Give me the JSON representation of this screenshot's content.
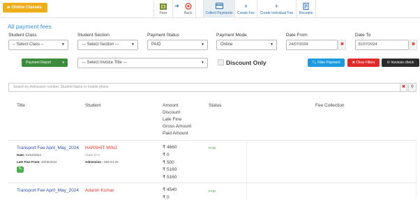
{
  "topbar": {
    "online_classes": "Online Classes",
    "tabs": [
      {
        "label": "Fees",
        "icon": "fees-icon"
      },
      {
        "label": "Back",
        "icon": "back-icon"
      },
      {
        "label": "Collect Payments",
        "icon": "collect-payments-icon"
      },
      {
        "label": "Create Fee",
        "icon": "plus-icon"
      },
      {
        "label": "Create Individual Fee",
        "icon": "plus-icon"
      },
      {
        "label": "Receipts",
        "icon": "receipts-icon"
      }
    ]
  },
  "page_title": "All payment fees",
  "filters": {
    "student_class": {
      "label": "Student Class",
      "value": "-- Select Class --"
    },
    "student_section": {
      "label": "Student Section",
      "value": "--- Select Section ---"
    },
    "payment_status": {
      "label": "Payment Status",
      "value": "PAID"
    },
    "payment_mode": {
      "label": "Payment Mode",
      "value": "Online"
    },
    "date_from": {
      "label": "Date From",
      "value": "24/07/2024"
    },
    "date_to": {
      "label": "Date To",
      "value": "31/07/2024"
    },
    "invoice_title": {
      "value": "--- Select Invoice Title ---"
    },
    "discount_only": "Discount Only"
  },
  "buttons": {
    "payment_report": "Payment Report",
    "filter_payment": "Filter Payment",
    "clear_filters": "Clear Filters",
    "invoices_check": "Invoices check"
  },
  "search": {
    "placeholder": "Search by Admission number, Student Name or mobile phone"
  },
  "table": {
    "headers": {
      "title": "Title",
      "student": "Student",
      "amount": "Amount",
      "discount": "Discount",
      "late_fine": "Late Fine",
      "gross_amount": "Gross Amount",
      "paid_amount": "Paid Amount",
      "status": "Status",
      "fee_collection": "Fee Collection"
    },
    "rows": [
      {
        "title": "Transport Fee April_May_2024",
        "date_label": "Date:",
        "date": "01/04/2024",
        "late_fine_label": "Late Fine From:",
        "late_fine_from": "20/05/2024",
        "student": "HARSHIT MINJ",
        "class": "Class IV-A",
        "admission_label": "Admission :",
        "admission": "360-24-25",
        "amounts": [
          "₹ 4660",
          "₹ 0",
          "₹ 500",
          "₹ 5160",
          "₹ 5160"
        ],
        "status": "PAID"
      },
      {
        "title": "Transport Fee April_May_2024",
        "student": "Adarsh Kumar",
        "amounts": [
          "₹ 4540",
          "₹ 0"
        ],
        "status": "PAID"
      }
    ]
  }
}
